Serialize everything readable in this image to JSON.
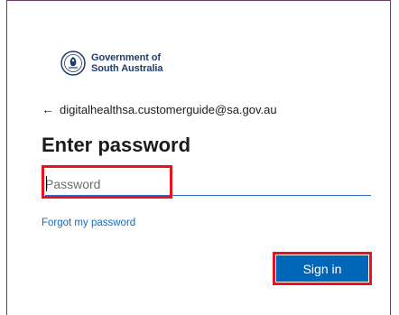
{
  "brand": {
    "name_line1": "Government of",
    "name_line2": "South Australia",
    "color": "#1f3e6e",
    "emblem_icon": "government-crest-icon"
  },
  "identity": {
    "back_icon": "arrow-left-icon",
    "email": "digitalhealthsa.customerguide@sa.gov.au"
  },
  "title": "Enter password",
  "password": {
    "placeholder": "Password",
    "value": ""
  },
  "links": {
    "forgot": "Forgot my password"
  },
  "actions": {
    "signin_label": "Sign in",
    "signin_color": "#0067b8"
  },
  "annotations": {
    "highlight_color": "#e8131e"
  }
}
